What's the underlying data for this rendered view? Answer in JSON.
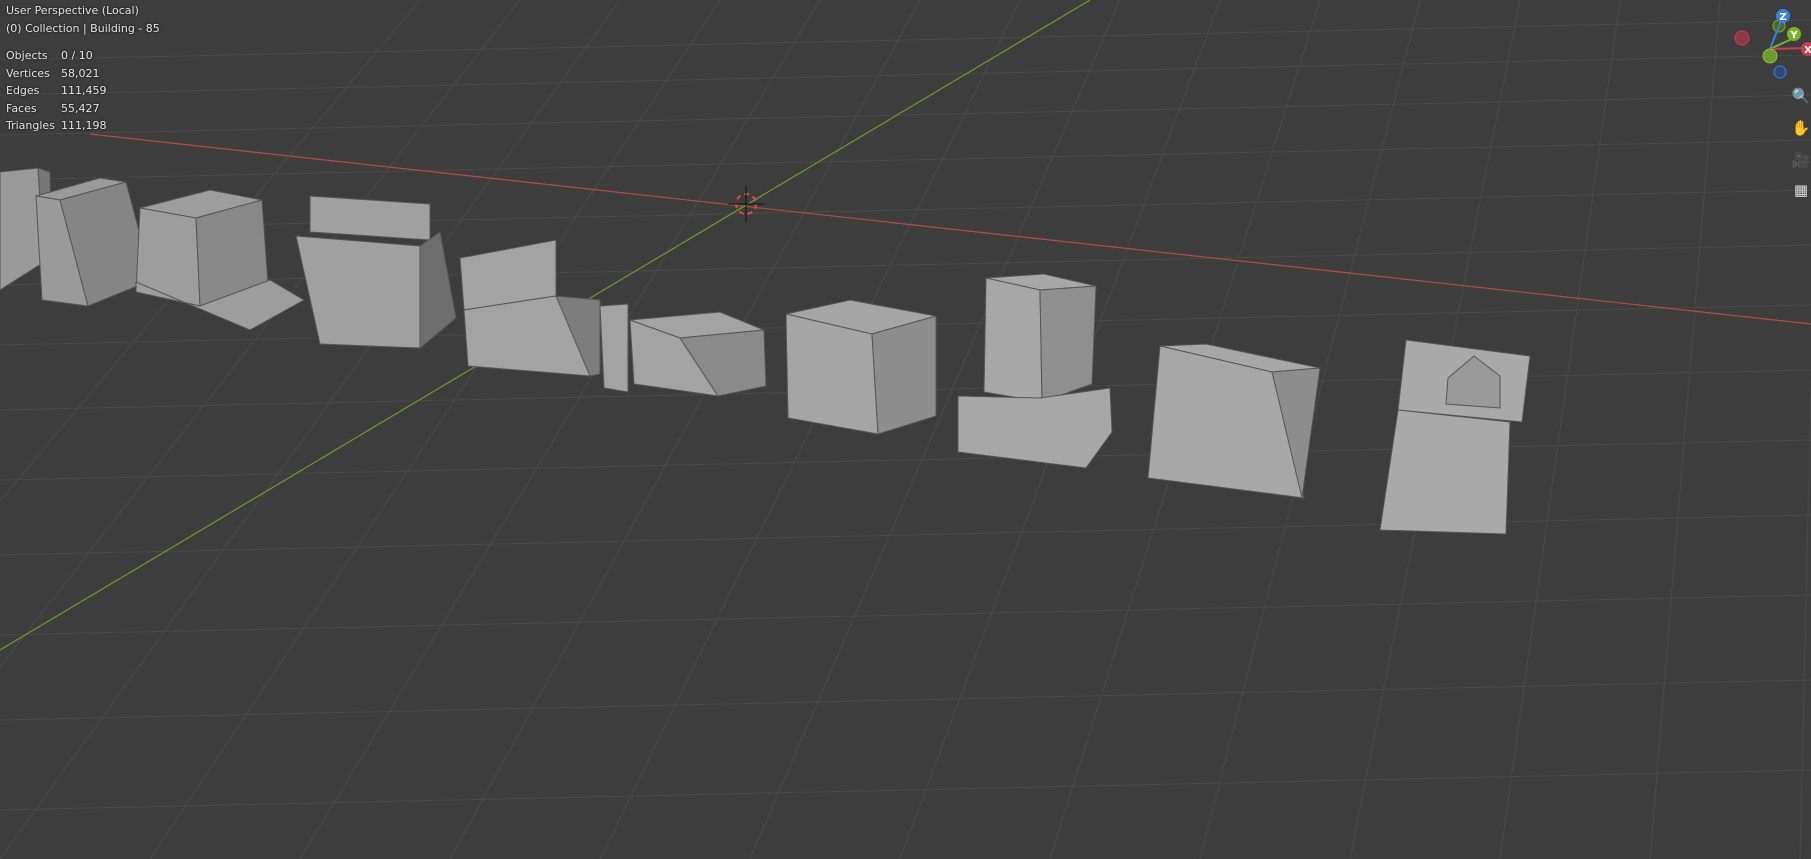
{
  "viewport": {
    "view_name": "User Perspective (Local)",
    "context": "(0) Collection | Building - 85"
  },
  "stats": [
    {
      "label": "Objects",
      "value": "0 / 10"
    },
    {
      "label": "Vertices",
      "value": "58,021"
    },
    {
      "label": "Edges",
      "value": "111,459"
    },
    {
      "label": "Faces",
      "value": "55,427"
    },
    {
      "label": "Triangles",
      "value": "111,198"
    }
  ],
  "gizmo": {
    "z_label": "Z",
    "y_label": "Y",
    "x_label": "X",
    "colors": {
      "x": "#c7404f",
      "y": "#7ab32a",
      "z": "#3c7fd8"
    }
  },
  "nav_icons": [
    "zoom-icon",
    "hand-pan-icon",
    "camera-icon",
    "grid-perspective-icon"
  ],
  "colors": {
    "background": "#3d3d3d",
    "grid": "#4a4a4a",
    "x_axis": "#b44a4a",
    "y_axis": "#6e9a2e",
    "building": "#8f8f8f"
  }
}
